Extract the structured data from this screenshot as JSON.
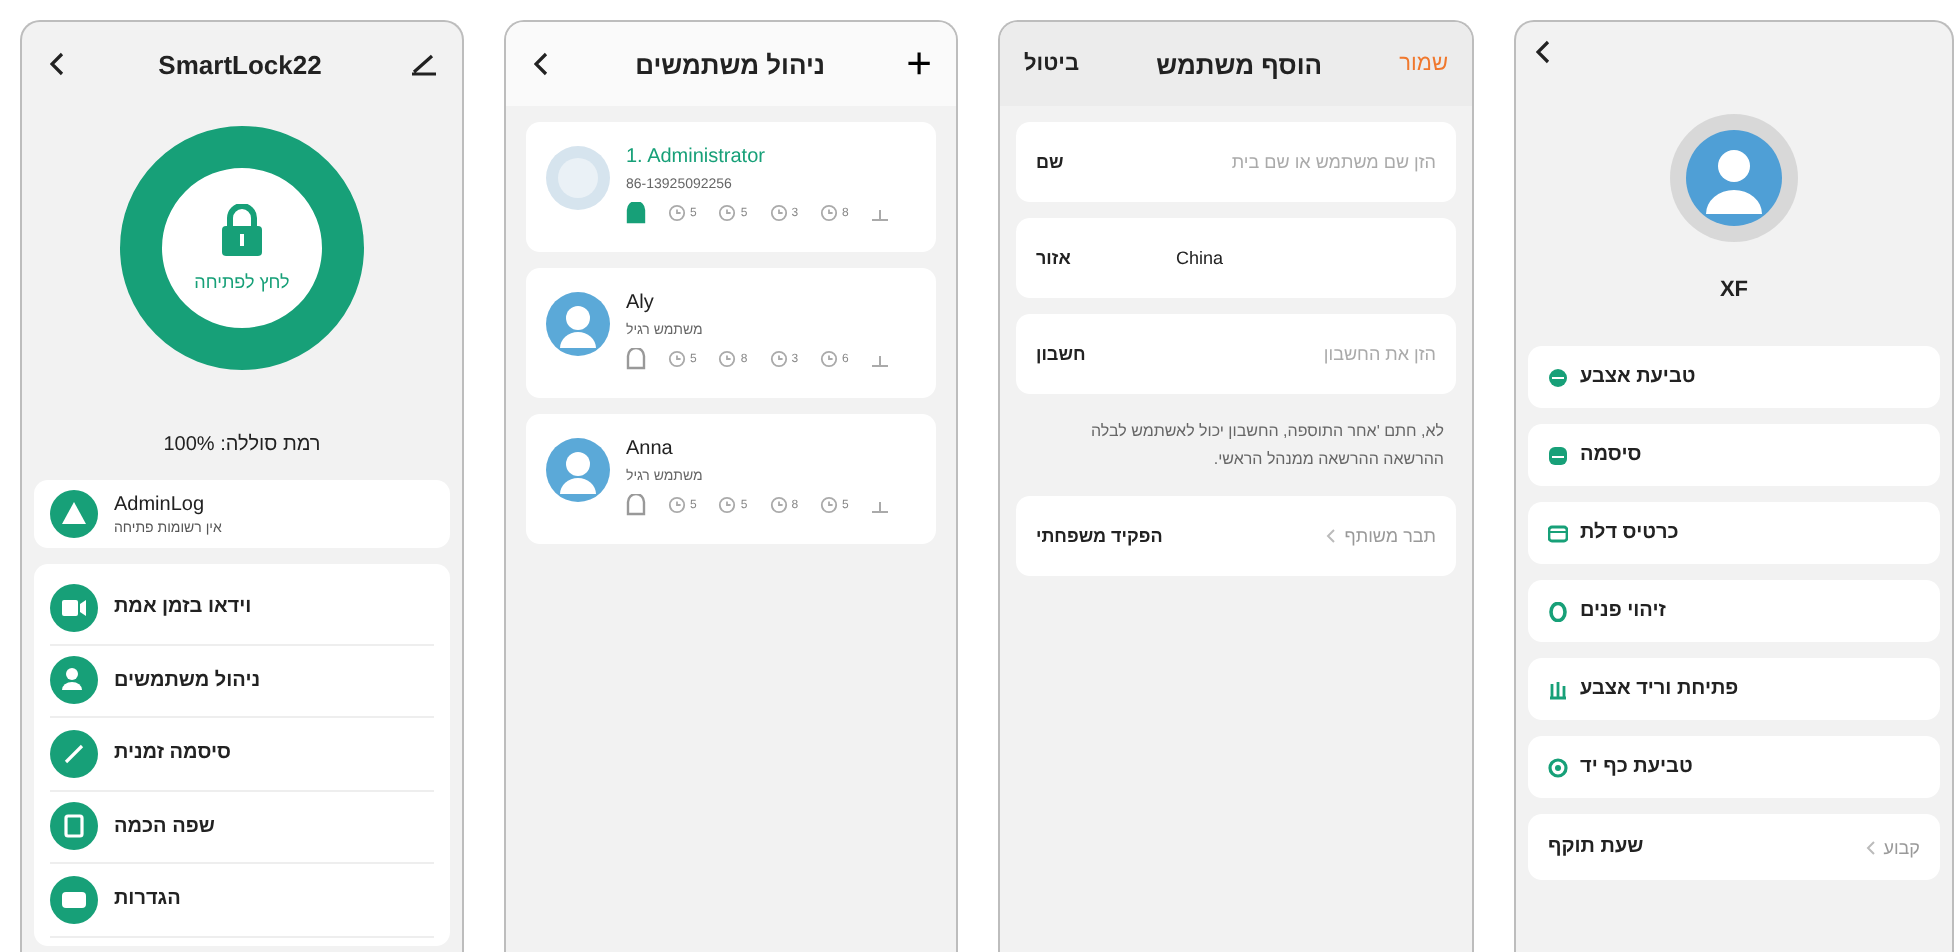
{
  "lock_screen": {
    "title": "SmartLock22",
    "unlock_label": "לחץ לפתיחה",
    "battery": "רמת סוללה: 100%",
    "log": {
      "title": "AdminLog",
      "subtitle": "אין רשומות פתיחה"
    },
    "menu": [
      "וידאו בזמן אמת",
      "ניהול משתמשים",
      "סיסמה זמנית",
      "שפה הכמה",
      "הגדרות"
    ]
  },
  "users_screen": {
    "title": "ניהול משתמשים",
    "add": "+",
    "users": [
      {
        "name": "1. Administrator",
        "detail": "86-13925092256",
        "highlighted": true,
        "counts": [
          "8",
          "3",
          "5",
          "5"
        ]
      },
      {
        "name": "Aly",
        "detail": "משתמש רגיל",
        "highlighted": false,
        "counts": [
          "6",
          "3",
          "8",
          "5"
        ]
      },
      {
        "name": "Anna",
        "detail": "משתמש רגיל",
        "highlighted": false,
        "counts": [
          "5",
          "8",
          "5",
          "5"
        ]
      }
    ]
  },
  "add_user_screen": {
    "cancel": "ביטול",
    "title": "הוסף משתמש",
    "save": "שמור",
    "fields": [
      {
        "label": "שם",
        "placeholder": "הזן שם משתמש או שם בית"
      },
      {
        "label": "אזור",
        "value": "China"
      },
      {
        "label": "חשבון",
        "placeholder": "הזן את החשבון"
      }
    ],
    "note": "לא, חתם 'אחר התוספה, החשבון יכול לאשתמש לבלה ההרשאה ההרשאה ממנהל הראשי.",
    "role": {
      "label": "הפקיד משפחתי",
      "value": "תבר משותף"
    }
  },
  "user_detail_screen": {
    "name": "XF",
    "methods": [
      "טביעת אצבע",
      "סיסמה",
      "כרטיס דלת",
      "זיהוי פנים",
      "פתיחת וריד אצבע",
      "טביעת כף יד"
    ],
    "validity": {
      "label": "שעת תוקף",
      "value": "קבוע"
    }
  }
}
